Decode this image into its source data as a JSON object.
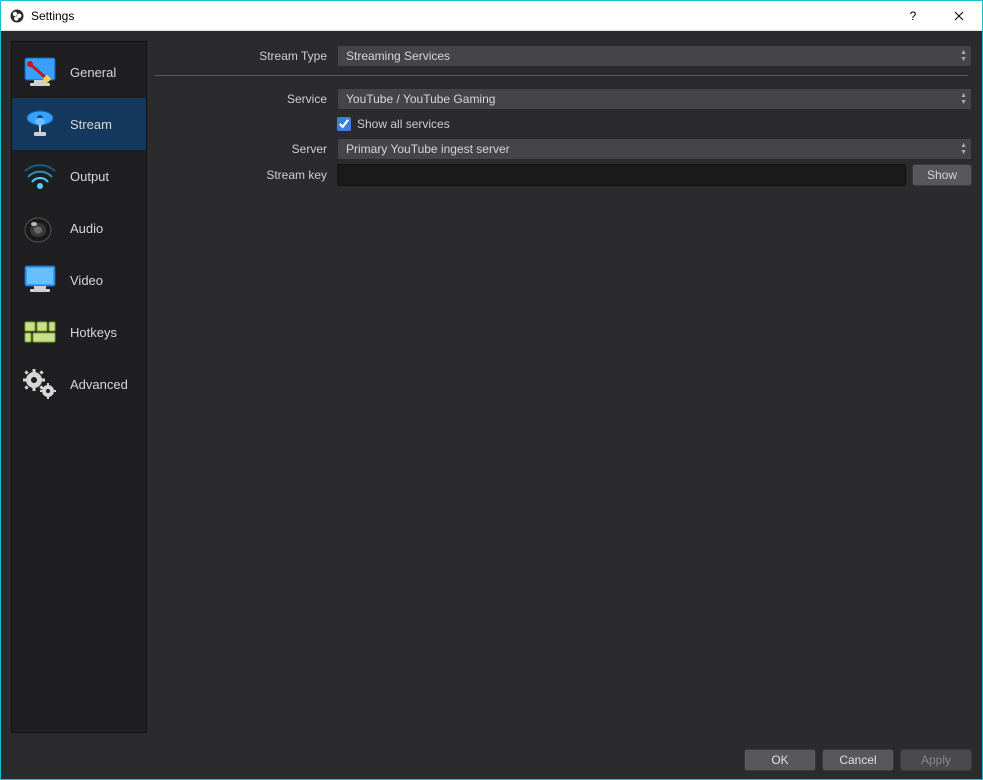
{
  "window": {
    "title": "Settings"
  },
  "titlebar": {
    "help": "?",
    "close": "✕"
  },
  "sidebar": {
    "items": [
      {
        "label": "General"
      },
      {
        "label": "Stream"
      },
      {
        "label": "Output"
      },
      {
        "label": "Audio"
      },
      {
        "label": "Video"
      },
      {
        "label": "Hotkeys"
      },
      {
        "label": "Advanced"
      }
    ],
    "active_index": 1
  },
  "form": {
    "stream_type": {
      "label": "Stream Type",
      "value": "Streaming Services"
    },
    "service": {
      "label": "Service",
      "value": "YouTube / YouTube Gaming"
    },
    "show_all": {
      "label": "Show all services",
      "checked": true
    },
    "server": {
      "label": "Server",
      "value": "Primary YouTube ingest server"
    },
    "stream_key": {
      "label": "Stream key",
      "value": "",
      "show_button": "Show"
    }
  },
  "buttons": {
    "ok": "OK",
    "cancel": "Cancel",
    "apply": "Apply"
  }
}
